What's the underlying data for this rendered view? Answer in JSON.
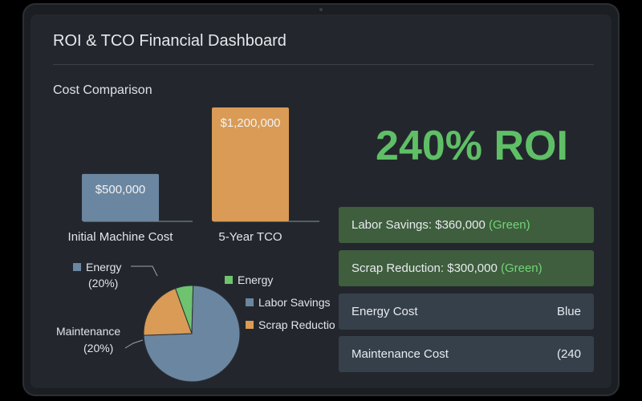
{
  "dashboard": {
    "title": "ROI & TCO Financial Dashboard"
  },
  "cost_comparison": {
    "section_title": "Cost Comparison"
  },
  "roi": {
    "headline": "240% ROI"
  },
  "cards": [
    {
      "label": "Labor Savings: $360,000",
      "tag": "(Green)",
      "style": "green"
    },
    {
      "label": "Scrap Reduction: $300,000",
      "tag": "(Green)",
      "style": "green"
    },
    {
      "label": "Energy Cost",
      "tag": "Blue",
      "style": "slate"
    },
    {
      "label": "Maintenance Cost",
      "tag": "(240",
      "style": "slate"
    }
  ],
  "pie": {
    "callouts": {
      "energy_name": "Energy",
      "energy_pct": "(20%)",
      "maintenance_name": "Maintenance",
      "maintenance_pct": "(20%)"
    },
    "legend": [
      {
        "label": "Energy",
        "color": "#6fc36f"
      },
      {
        "label": "Labor Savings",
        "color": "#6b86a0"
      },
      {
        "label": "Scrap Reduction",
        "color": "#d99b55"
      }
    ]
  },
  "colors": {
    "bar_initial": "#6b86a0",
    "bar_tco": "#d99b55",
    "pie_energy": "#6fc36f",
    "pie_labor": "#6b86a0",
    "pie_scrap": "#d99b55",
    "accent_green": "#5fbf66"
  },
  "chart_data": [
    {
      "type": "bar",
      "title": "Cost Comparison",
      "categories": [
        "Initial Machine Cost",
        "5-Year TCO"
      ],
      "values": [
        500000,
        1200000
      ],
      "data_labels": [
        "$500,000",
        "$1,200,000"
      ],
      "colors": [
        "#6b86a0",
        "#d99b55"
      ],
      "ylim": [
        0,
        1200000
      ],
      "grid": false
    },
    {
      "type": "pie",
      "slices": [
        {
          "label": "Energy",
          "value": 6,
          "color": "#6fc36f"
        },
        {
          "label": "Labor Savings",
          "value": 74,
          "color": "#6b86a0"
        },
        {
          "label": "Scrap Reduction",
          "value": 20,
          "color": "#d99b55"
        }
      ],
      "legend_position": "right"
    }
  ]
}
